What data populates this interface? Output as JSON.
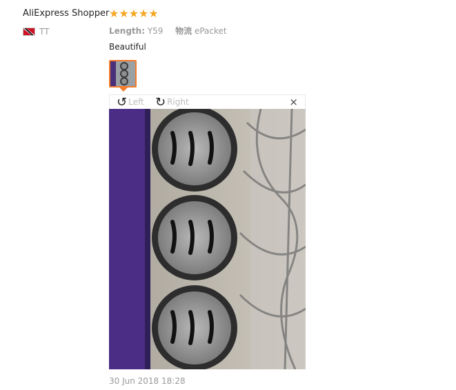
{
  "review": {
    "user_name": "AliExpress Shopper",
    "country_code": "TT",
    "rating_stars": "★★★★★",
    "rating": 5,
    "attributes": [
      {
        "key": "Length:",
        "value": "Y59"
      },
      {
        "key": "物流",
        "value": "ePacket"
      }
    ],
    "text": "Beautiful",
    "date": "30 Jun 2018 18:28"
  },
  "viewer": {
    "rotate_left_label": "Left",
    "rotate_right_label": "Right",
    "close_symbol": "×",
    "icons": {
      "rotate_left": "rotate-left-icon",
      "rotate_right": "rotate-right-icon",
      "close": "close-icon"
    }
  },
  "colors": {
    "star": "#f5a623",
    "thumb_border": "#f47c2a",
    "muted_text": "#999999"
  }
}
